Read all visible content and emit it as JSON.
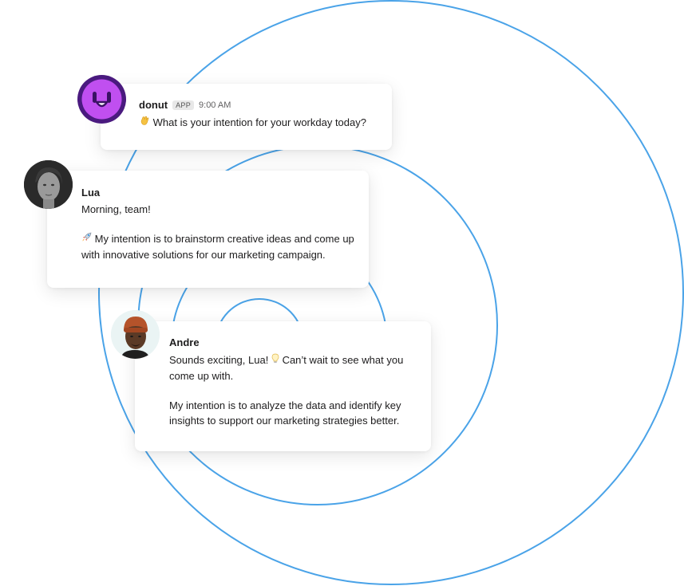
{
  "theme": {
    "ring_color": "#4aa3e8",
    "donut_avatar_color": "#c04ff0",
    "donut_avatar_ring": "#4a1a7f"
  },
  "messages": {
    "donut": {
      "name": "donut",
      "badge": "APP",
      "time": "9:00 AM",
      "emoji_icon": "waving-hand-icon",
      "text": "What is your intention for your workday today?"
    },
    "lua": {
      "name": "Lua",
      "line1": "Morning, team!",
      "emoji_icon": "rocket-icon",
      "line2": "My intention is to brainstorm creative ideas and come up with innovative solutions for our marketing campaign."
    },
    "andre": {
      "name": "Andre",
      "line1_part1": "Sounds exciting, Lua!",
      "emoji_icon": "light-bulb-icon",
      "line1_part2": "Can’t wait to see what you come up with.",
      "line2": "My intention is to analyze the data and identify key insights to support our marketing strategies better."
    }
  }
}
